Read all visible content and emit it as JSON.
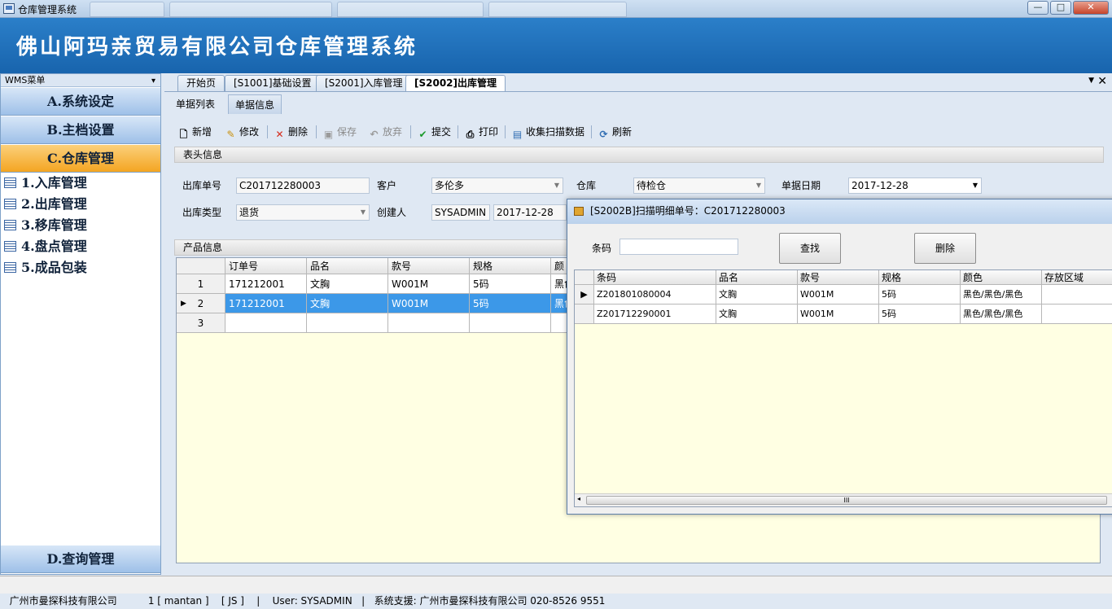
{
  "window": {
    "title": "仓库管理系统",
    "buttons": {
      "minimize": "—",
      "maximize": "□",
      "close": "✕"
    }
  },
  "banner": {
    "title": "佛山阿玛亲贸易有限公司仓库管理系统"
  },
  "sidebar": {
    "header": "WMS菜单",
    "groups": [
      {
        "label": "A.系统设定"
      },
      {
        "label": "B.主档设置"
      },
      {
        "label": "C.仓库管理"
      }
    ],
    "items": [
      {
        "label": "1.入库管理"
      },
      {
        "label": "2.出库管理"
      },
      {
        "label": "3.移库管理"
      },
      {
        "label": "4.盘点管理"
      },
      {
        "label": "5.成品包装"
      }
    ],
    "bottom_group": {
      "label": "D.查询管理"
    }
  },
  "tabs": [
    {
      "label": "开始页"
    },
    {
      "label": "[S1001]基础设置"
    },
    {
      "label": "[S2001]入库管理"
    },
    {
      "label": "[S2002]出库管理"
    }
  ],
  "subtabs": [
    {
      "label": "单据列表"
    },
    {
      "label": "单据信息"
    }
  ],
  "toolbar": {
    "new": "新增",
    "edit": "修改",
    "delete": "删除",
    "save": "保存",
    "discard": "放弃",
    "submit": "提交",
    "print": "打印",
    "collect": "收集扫描数据",
    "refresh": "刷新"
  },
  "header_section": {
    "title": "表头信息",
    "order_no_label": "出库单号",
    "order_no": "C201712280003",
    "customer_label": "客户",
    "customer": "多伦多",
    "warehouse_label": "仓库",
    "warehouse": "待检仓",
    "date_label": "单据日期",
    "date": "2017-12-28",
    "type_label": "出库类型",
    "type": "退货",
    "creator_label": "创建人",
    "creator": "SYSADMIN",
    "created_date": "2017-12-28"
  },
  "product_section": {
    "title": "产品信息",
    "columns": [
      "订单号",
      "品名",
      "款号",
      "规格",
      "颜"
    ],
    "rows": [
      {
        "num": "1",
        "cells": [
          "171212001",
          "文胸",
          "W001M",
          "5码",
          "黑色"
        ]
      },
      {
        "num": "2",
        "cells": [
          "171212001",
          "文胸",
          "W001M",
          "5码",
          "黑色"
        ]
      },
      {
        "num": "3",
        "cells": [
          "",
          "",
          "",
          "",
          ""
        ]
      }
    ]
  },
  "dialog": {
    "title": "[S2002B]扫描明细单号：C201712280003",
    "barcode_label": "条码",
    "barcode_value": "",
    "search_button": "查找",
    "delete_button": "删除",
    "columns": [
      "条码",
      "品名",
      "款号",
      "规格",
      "颜色",
      "存放区域"
    ],
    "rows": [
      [
        "Z201801080004",
        "文胸",
        "W001M",
        "5码",
        "黑色/黑色/黑色",
        ""
      ],
      [
        "Z201712290001",
        "文胸",
        "W001M",
        "5码",
        "黑色/黑色/黑色",
        ""
      ]
    ],
    "scroll_grip": "III"
  },
  "statusbar": {
    "company": "广州市曼探科技有限公司",
    "session": "1 [ mantan ]",
    "code": "[ JS ]",
    "user": "User: SYSADMIN",
    "support": "系统支援: 广州市曼探科技有限公司 020-8526 9551"
  },
  "colors": {
    "banner": "#1f73bd",
    "active_group": "#f4a522",
    "selected_row": "#3c98e8",
    "grid_bg": "#ffffe3"
  }
}
